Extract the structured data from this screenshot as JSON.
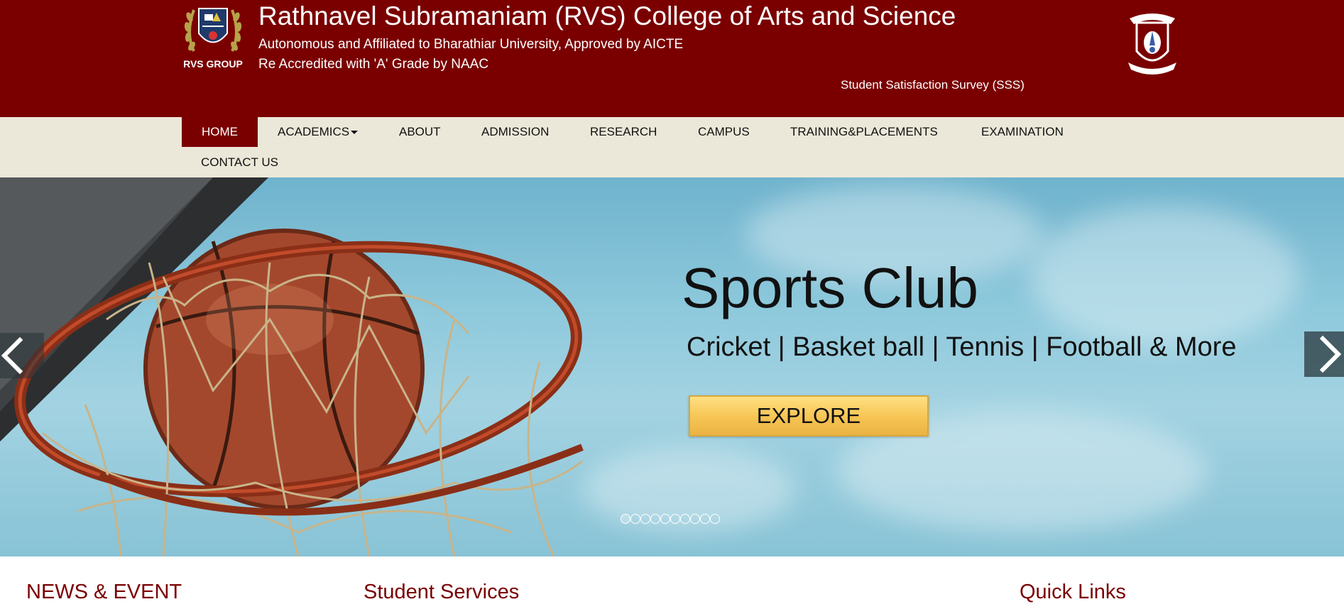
{
  "header": {
    "logo_label": "RVS GROUP",
    "title": "Rathnavel Subramaniam (RVS) College of Arts and Science",
    "subtitle_1": "Autonomous and Affiliated to Bharathiar University, Approved by AICTE",
    "subtitle_2": "Re Accredited with 'A' Grade by NAAC",
    "survey_link": "Student Satisfaction Survey (SSS)"
  },
  "nav": {
    "items": [
      {
        "label": "HOME",
        "active": true
      },
      {
        "label": "ACADEMICS"
      },
      {
        "label": "ABOUT"
      },
      {
        "label": "ADMISSION"
      },
      {
        "label": "RESEARCH"
      },
      {
        "label": "CAMPUS"
      },
      {
        "label": "TRAINING&PLACEMENTS"
      },
      {
        "label": "EXAMINATION"
      },
      {
        "label": "CONTACT US"
      }
    ]
  },
  "slider": {
    "title": "Sports Club",
    "subtitle": "Cricket | Basket ball | Tennis | Football & More",
    "button_label": "EXPLORE",
    "slide_count": 10,
    "active_slide": 1
  },
  "sections": {
    "news": "NEWS & EVENT",
    "student_services": "Student Services",
    "quick_links": "Quick Links"
  },
  "colors": {
    "brand": "#7a0000",
    "nav_background": "#ece8d9",
    "button": "#f6c453"
  }
}
